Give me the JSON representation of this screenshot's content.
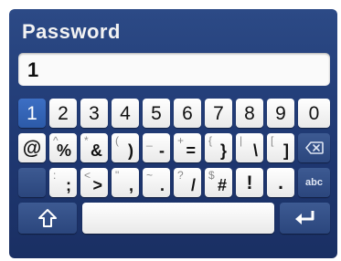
{
  "title": "Password",
  "password_field": {
    "value": "1"
  },
  "keyboard": {
    "row1": [
      "1",
      "2",
      "3",
      "4",
      "5",
      "6",
      "7",
      "8",
      "9",
      "0"
    ],
    "row2": [
      {
        "main": "@",
        "alt": ""
      },
      {
        "main": "%",
        "alt": "^"
      },
      {
        "main": "&",
        "alt": "*"
      },
      {
        "main": ")",
        "alt": "("
      },
      {
        "main": "-",
        "alt": "_"
      },
      {
        "main": "=",
        "alt": "+"
      },
      {
        "main": "}",
        "alt": "{"
      },
      {
        "main": "\\",
        "alt": "|"
      },
      {
        "main": "]",
        "alt": "["
      }
    ],
    "row3": [
      {
        "main": ";",
        "alt": ":"
      },
      {
        "main": ">",
        "alt": "<"
      },
      {
        "main": ",",
        "alt": "\""
      },
      {
        "main": ".",
        "alt": "~"
      },
      {
        "main": "/",
        "alt": "?"
      },
      {
        "main": "#",
        "alt": "$"
      },
      {
        "main": "!",
        "alt": ""
      },
      {
        "main": ".",
        "alt": ""
      }
    ],
    "abc_label": "abc",
    "icons": {
      "backspace": "backspace-icon",
      "shift": "shift-icon",
      "enter": "enter-icon"
    }
  },
  "colors": {
    "background": "#1f3872",
    "key": "#f2f2f2",
    "key_dark": "#2b467d",
    "key_active": "#2c5aa8"
  }
}
